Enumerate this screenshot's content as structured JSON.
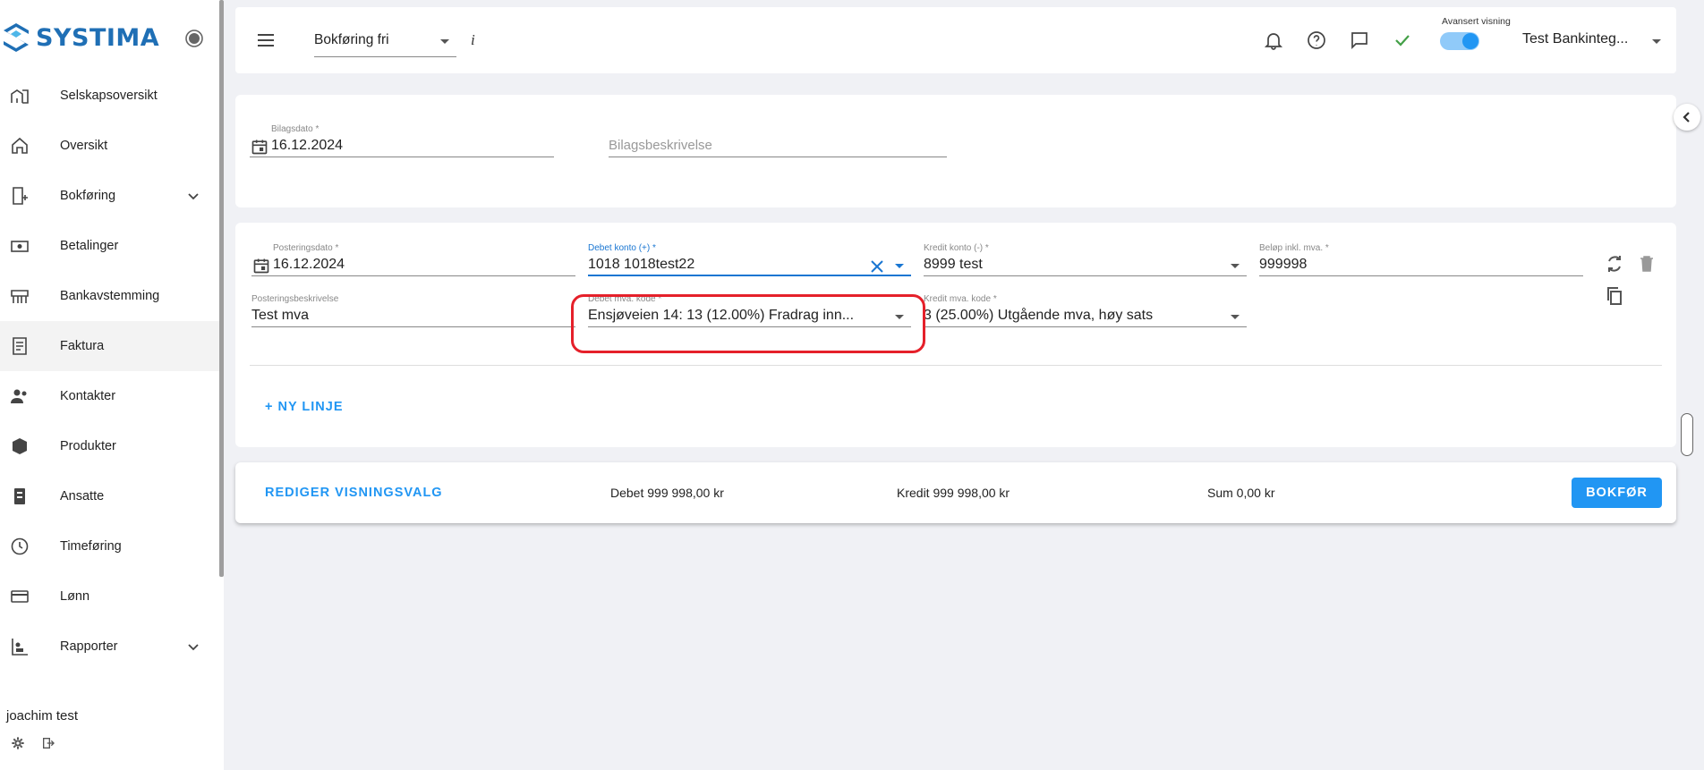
{
  "app": {
    "logo_text": "SYSTIMA",
    "accent": "#2196f3"
  },
  "sidebar": {
    "items": [
      {
        "label": "Selskapsoversikt",
        "icon": "company-building-icon"
      },
      {
        "label": "Oversikt",
        "icon": "home-icon"
      },
      {
        "label": "Bokføring",
        "icon": "bookkeeping-icon",
        "expandable": true
      },
      {
        "label": "Betalinger",
        "icon": "payment-icon"
      },
      {
        "label": "Bankavstemming",
        "icon": "bank-reconcile-icon"
      },
      {
        "label": "Faktura",
        "icon": "invoice-icon",
        "active": true
      },
      {
        "label": "Kontakter",
        "icon": "contacts-icon"
      },
      {
        "label": "Produkter",
        "icon": "product-box-icon"
      },
      {
        "label": "Ansatte",
        "icon": "employee-badge-icon"
      },
      {
        "label": "Timeføring",
        "icon": "clock-icon"
      },
      {
        "label": "Lønn",
        "icon": "payroll-card-icon"
      },
      {
        "label": "Rapporter",
        "icon": "reports-icon",
        "expandable": true
      }
    ],
    "user_name": "joachim test"
  },
  "header": {
    "mode_select": "Bokføring fri",
    "info": "i",
    "toggle_label": "Avansert visning",
    "toggle_on": true,
    "company": "Test Bankinteg..."
  },
  "voucher": {
    "date_label": "Bilagsdato *",
    "date_value": "16.12.2024",
    "description_placeholder": "Bilagsbeskrivelse"
  },
  "posting": {
    "posting_date_label": "Posteringsdato *",
    "posting_date_value": "16.12.2024",
    "debit_account_label": "Debet konto (+) *",
    "debit_account_value": "1018 1018test22",
    "credit_account_label": "Kredit konto (-) *",
    "credit_account_value": "8999 test",
    "amount_label": "Beløp inkl. mva. *",
    "amount_value": "999998",
    "description_label": "Posteringsbeskrivelse",
    "description_value": "Test mva",
    "debit_vat_label": "Debet mva. kode *",
    "debit_vat_value": "Ensjøveien 14: 13 (12.00%) Fradrag inn...",
    "credit_vat_label": "Kredit mva. kode *",
    "credit_vat_value": "3 (25.00%) Utgående mva, høy sats",
    "new_line": "+ NY LINJE"
  },
  "footer": {
    "edit_view": "REDIGER VISNINGSVALG",
    "debit_sum": "Debet 999 998,00 kr",
    "credit_sum": "Kredit 999 998,00 kr",
    "sum": "Sum 0,00 kr",
    "post_button": "BOKFØR"
  },
  "colors": {
    "highlight": "#e5202a",
    "success": "#43a047"
  }
}
